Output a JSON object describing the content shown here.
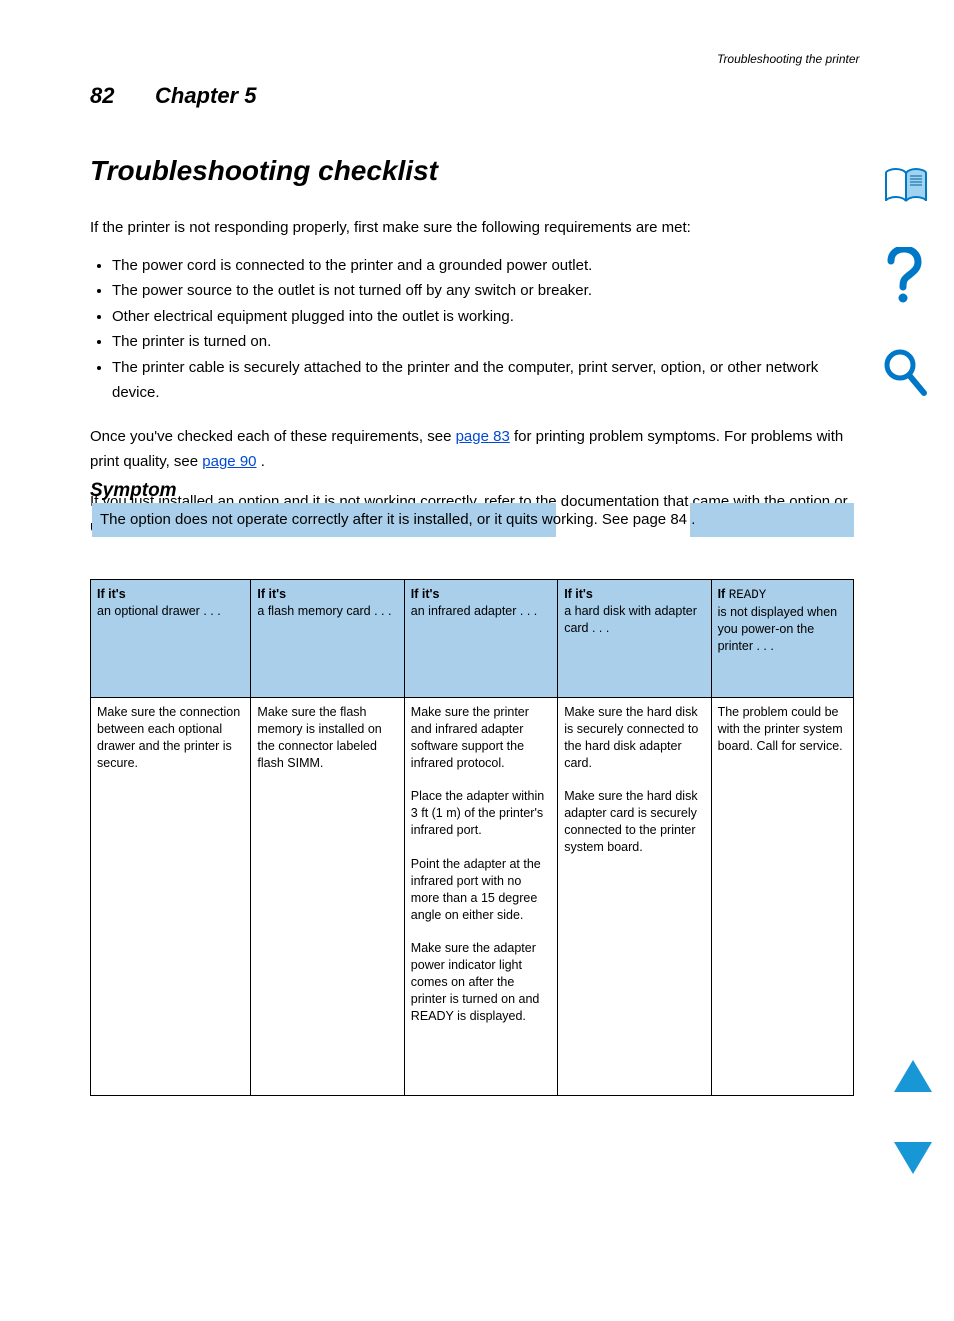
{
  "header": "Troubleshooting the printer",
  "page_number": "82",
  "chapter": "Chapter 5",
  "section_title": "Troubleshooting checklist",
  "intro_1": "If the printer is not responding properly, first make sure the following requirements are met:",
  "intro_bullets": [
    "The power cord is connected to the printer and a grounded power outlet.",
    "The power source to the outlet is not turned off by any switch or breaker.",
    "Other electrical equipment plugged into the outlet is working.",
    "The printer is turned on.",
    "The printer cable is securely attached to the printer and the computer, print server, option, or other network device."
  ],
  "intro_2_a": "Once you've checked each of these requirements, see ",
  "intro_2_link1": "page 83",
  "intro_2_b": " for printing problem symptoms. For problems with print quality, see ",
  "intro_2_link2": "page 90",
  "intro_2_c": ".",
  "intro_3": "If you just installed an option and it is not working correctly, refer to the documentation that came with the option or use the following tips.",
  "symptom_label": "Symptom",
  "symptom_text_a": "The option does not operate correctly after it is installed, or it quits working. See ",
  "symptom_text_link": "page 84",
  "symptom_text_b": ".",
  "columns": [
    {
      "title1": "If it's",
      "title2": "an optional drawer . . ."
    },
    {
      "title1": "If it's",
      "title2": "a flash memory card . . ."
    },
    {
      "title1": "If it's",
      "title2": "an infrared adapter . . ."
    },
    {
      "title1": "If it's",
      "title2": "a hard disk with adapter card . . ."
    },
    {
      "title1": "If ",
      "ready": "READY",
      "title2": " is not displayed when you power-on the printer . . ."
    }
  ],
  "body_cells": [
    "Make sure the connection between each optional drawer and the printer is secure.",
    "Make sure the flash memory is installed on the connector labeled flash SIMM.",
    "Make sure the printer and infrared adapter software support the infrared protocol.\n\nPlace the adapter within 3 ft (1 m) of the printer's infrared port.\n\nPoint the adapter at the infrared port with no more than a 15 degree angle on either side.\n\nMake sure the adapter power indicator light comes on after the printer is turned on and READY is displayed.",
    "Make sure the hard disk is securely connected to the hard disk adapter card.\n\nMake sure the hard disk adapter card is securely connected to the printer system board.",
    "The problem could be with the printer system board. Call for service."
  ]
}
